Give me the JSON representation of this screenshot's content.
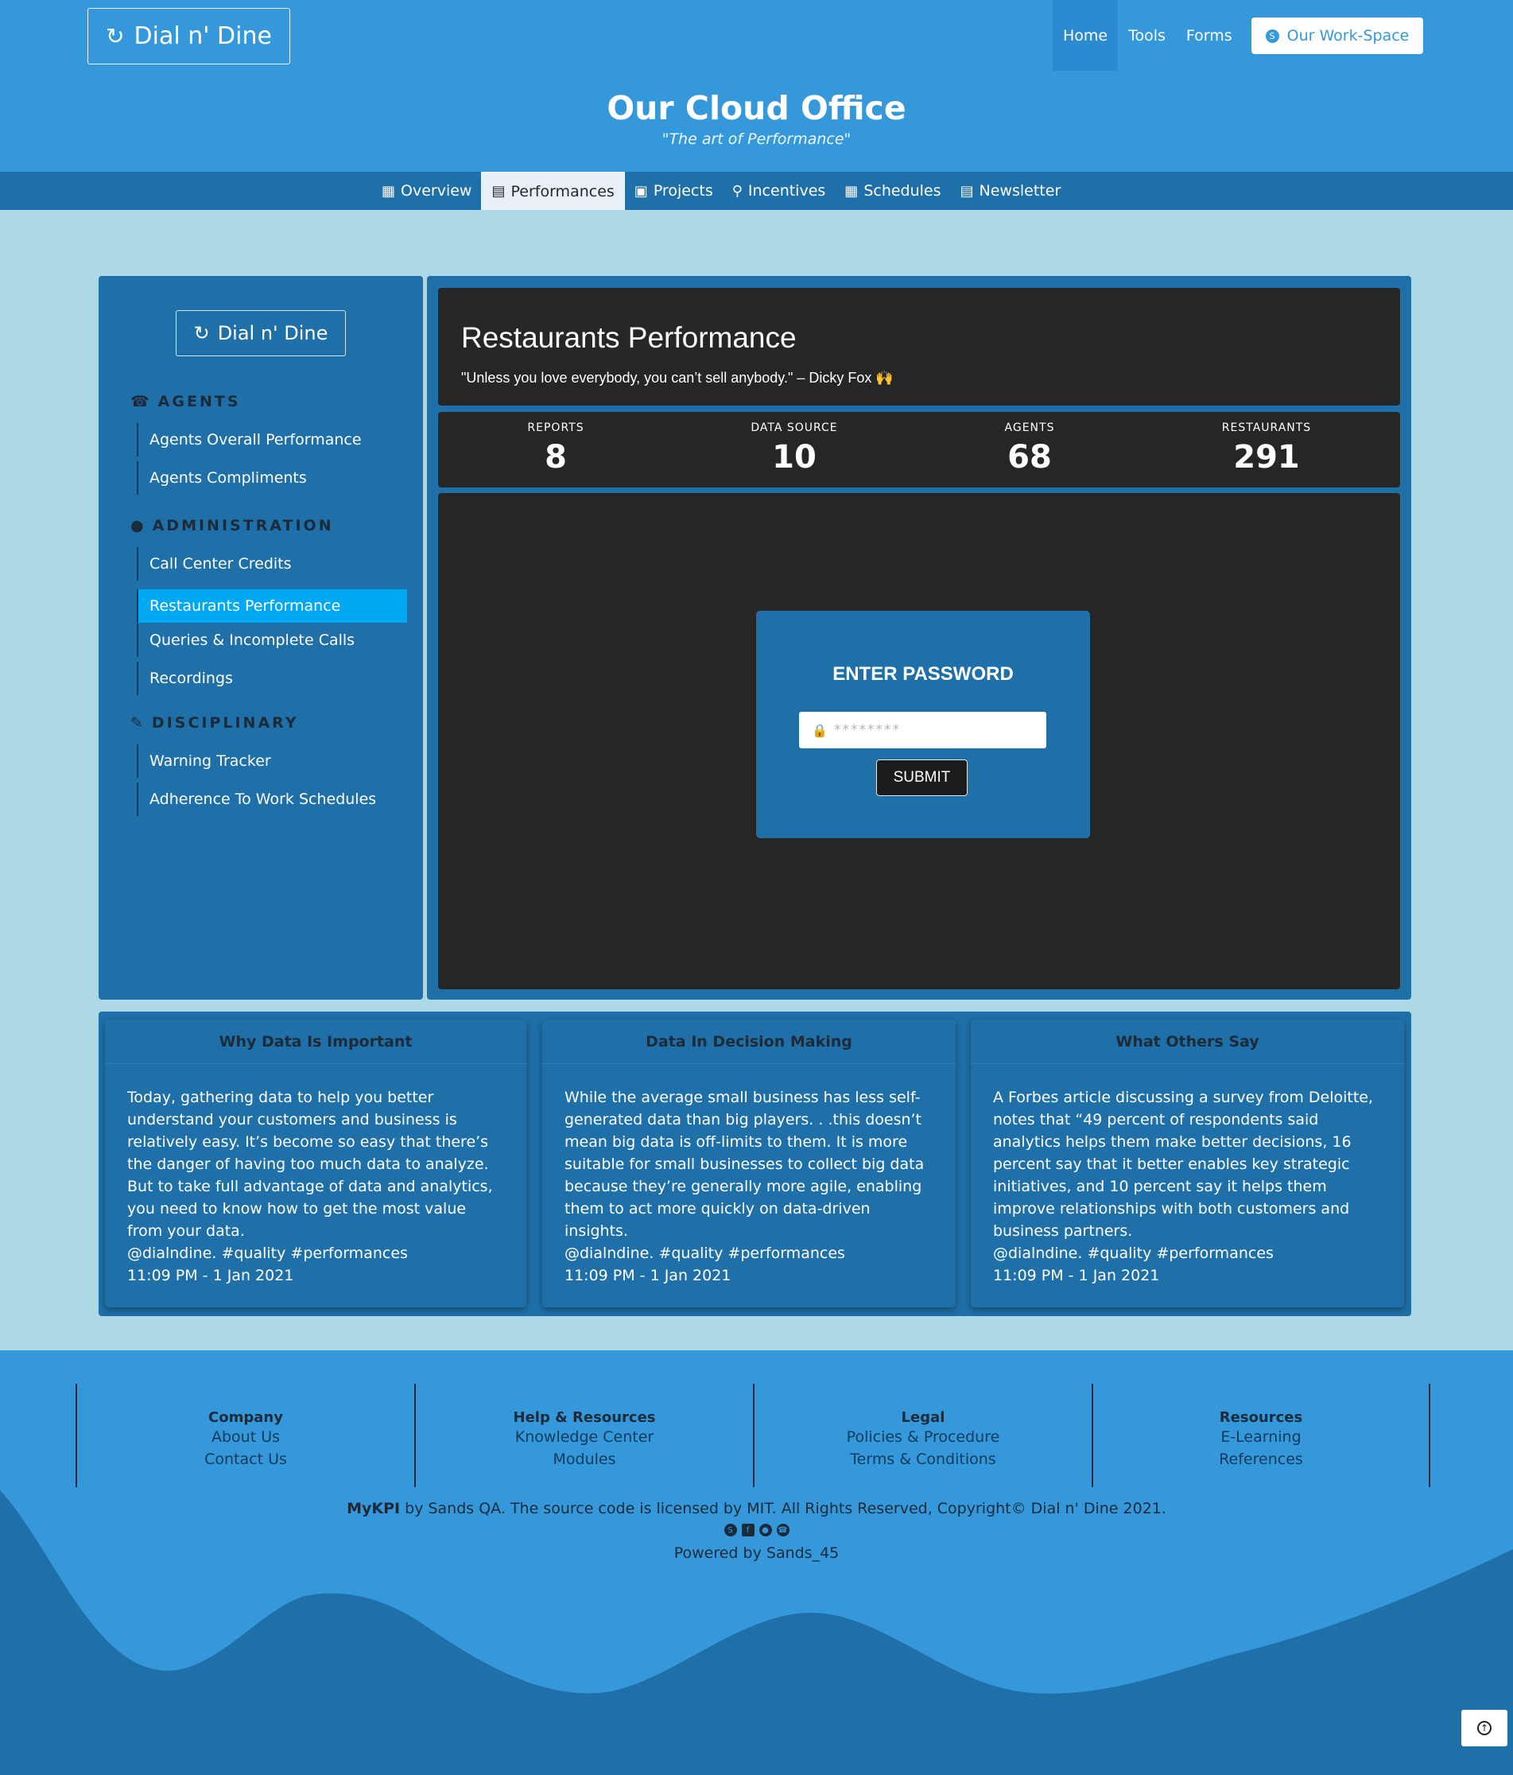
{
  "header": {
    "brand": "Dial n' Dine",
    "nav": [
      "Home",
      "Tools",
      "Forms"
    ],
    "workspace_button": "Our Work-Space",
    "title": "Our Cloud Office",
    "subtitle": "\"The art of Performance\""
  },
  "tabs": [
    {
      "label": "Overview",
      "icon": "sitemap-icon"
    },
    {
      "label": "Performances",
      "icon": "chart-area-icon"
    },
    {
      "label": "Projects",
      "icon": "project-diagram-icon"
    },
    {
      "label": "Incentives",
      "icon": "award-icon"
    },
    {
      "label": "Schedules",
      "icon": "calendar-icon"
    },
    {
      "label": "Newsletter",
      "icon": "newspaper-icon"
    }
  ],
  "sidebar": {
    "brand": "Dial n' Dine",
    "sections": [
      {
        "title": "AGENTS",
        "icon": "headset-icon",
        "items": [
          "Agents Overall Performance",
          "Agents Compliments"
        ]
      },
      {
        "title": "ADMINISTRATION",
        "icon": "users-icon",
        "items": [
          "Call Center Credits",
          "Restaurants Performance",
          "Queries & Incomplete Calls",
          "Recordings"
        ]
      },
      {
        "title": "DISCIPLINARY",
        "icon": "file-signature-icon",
        "items": [
          "Warning Tracker",
          "Adherence To Work Schedules"
        ]
      }
    ],
    "active_item": "Restaurants Performance"
  },
  "main": {
    "title": "Restaurants Performance",
    "quote": "\"Unless you love everybody, you can’t sell anybody.\" – Dicky Fox 🙌",
    "stats": [
      {
        "label": "REPORTS",
        "value": "8"
      },
      {
        "label": "DATA SOURCE",
        "value": "10"
      },
      {
        "label": "AGENTS",
        "value": "68"
      },
      {
        "label": "RESTAURANTS",
        "value": "291"
      }
    ],
    "password": {
      "heading": "ENTER PASSWORD",
      "placeholder": "********",
      "submit": "SUBMIT"
    }
  },
  "cards": [
    {
      "title": "Why Data Is Important",
      "body": "Today, gathering data to help you better understand your customers and business is relatively easy. It’s become so easy that there’s the danger of having too much data to analyze. But to take full advantage of data and analytics, you need to know how to get the most value from your data.",
      "tags": "@dialndine. #quality #performances",
      "time": "11:09 PM - 1 Jan 2021"
    },
    {
      "title": "Data In Decision Making",
      "body": "While the average small business has less self-generated data than big players. . .this doesn’t mean big data is off-limits to them. It is more suitable for small businesses to collect big data because they’re generally more agile, enabling them to act more quickly on data-driven insights.",
      "tags": "@dialndine. #quality #performances",
      "time": "11:09 PM - 1 Jan 2021"
    },
    {
      "title": "What Others Say",
      "body": "A Forbes article discussing a survey from Deloitte, notes that “49 percent of respondents said analytics helps them make better decisions, 16 percent say that it better enables key strategic initiatives, and 10 percent say it helps them improve relationships with both customers and business partners.",
      "tags": "@dialndine. #quality #performances",
      "time": "11:09 PM - 1 Jan 2021"
    }
  ],
  "footer": {
    "columns": [
      {
        "title": "Company",
        "links": [
          "About Us",
          "Contact Us"
        ]
      },
      {
        "title": "Help & Resources",
        "links": [
          "Knowledge Center",
          "Modules"
        ]
      },
      {
        "title": "Legal",
        "links": [
          "Policies & Procedure",
          "Terms & Conditions"
        ]
      },
      {
        "title": "Resources",
        "links": [
          "E-Learning",
          "References"
        ]
      }
    ],
    "license_brand": "MyKPI",
    "license_text": " by Sands QA. The source code is licensed by MIT. All Rights Reserved, Copyright© Dial n' Dine 2021.",
    "powered": "Powered by Sands_45",
    "social_icons": [
      "skype-icon",
      "facebook-icon",
      "github-icon",
      "whatsapp-icon"
    ]
  },
  "colors": {
    "header": "#3498db",
    "panel": "#1f6fa8",
    "dark": "#262626",
    "active_item": "#00a8f3",
    "page_bg": "#add8e6"
  }
}
